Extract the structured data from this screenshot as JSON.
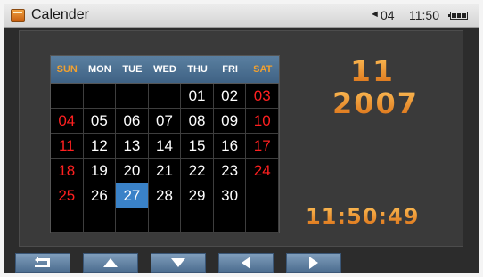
{
  "statusbar": {
    "app_icon": "calendar-app-icon",
    "title": "Calender",
    "volume_icon": "speaker-icon",
    "volume_level": "04",
    "clock": "11:50",
    "battery_icon": "battery-icon"
  },
  "calendar": {
    "weekdays": [
      "SUN",
      "MON",
      "TUE",
      "WED",
      "THU",
      "FRI",
      "SAT"
    ],
    "weeks": [
      [
        "",
        "",
        "",
        "",
        "01",
        "02",
        "03"
      ],
      [
        "04",
        "05",
        "06",
        "07",
        "08",
        "09",
        "10"
      ],
      [
        "11",
        "12",
        "13",
        "14",
        "15",
        "16",
        "17"
      ],
      [
        "18",
        "19",
        "20",
        "21",
        "22",
        "23",
        "24"
      ],
      [
        "25",
        "26",
        "27",
        "28",
        "29",
        "30",
        ""
      ],
      [
        "",
        "",
        "",
        "",
        "",
        "",
        ""
      ]
    ],
    "selected_day": "27"
  },
  "display": {
    "month": "11",
    "year": "2007",
    "time": "11:50:49"
  },
  "colors": {
    "accent_orange": "#f09a30",
    "weekend_red": "#ff2020",
    "selected_blue": "#3a82c8",
    "header_blue": "#4f7396"
  },
  "toolbar": {
    "buttons": [
      {
        "name": "back-button",
        "icon": "return-arrow-icon"
      },
      {
        "name": "up-button",
        "icon": "triangle-up-icon"
      },
      {
        "name": "down-button",
        "icon": "triangle-down-icon"
      },
      {
        "name": "left-button",
        "icon": "triangle-left-icon"
      },
      {
        "name": "right-button",
        "icon": "triangle-right-icon"
      }
    ]
  }
}
